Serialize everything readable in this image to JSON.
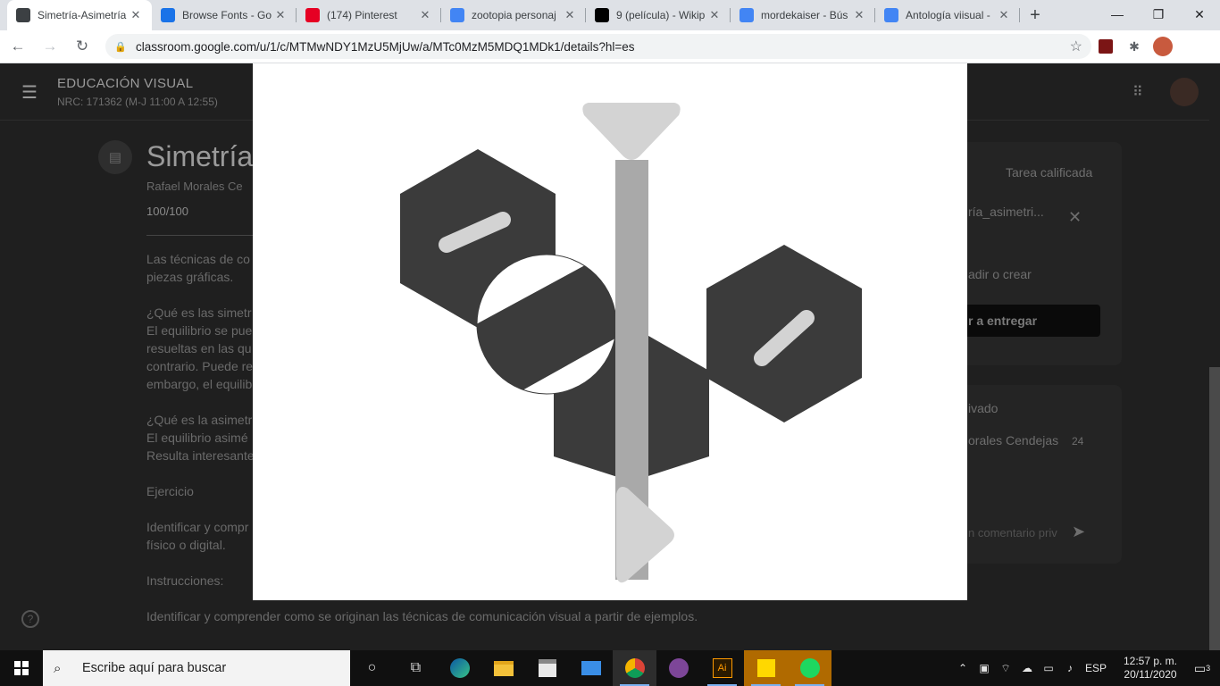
{
  "browser": {
    "tabs": [
      {
        "title": "Simetría-Asimetría",
        "favicon": "classroom-icon",
        "color": "#3c4043",
        "active": true
      },
      {
        "title": "Browse Fonts - Go",
        "favicon": "google-fonts-icon",
        "color": "#1a73e8",
        "active": false
      },
      {
        "title": "(174) Pinterest",
        "favicon": "pinterest-icon",
        "color": "#e60023",
        "active": false
      },
      {
        "title": "zootopia personaj",
        "favicon": "google-icon",
        "color": "#4285f4",
        "active": false
      },
      {
        "title": "9 (película) - Wikip",
        "favicon": "wikipedia-icon",
        "color": "#000000",
        "active": false
      },
      {
        "title": "mordekaiser - Bús",
        "favicon": "google-icon",
        "color": "#4285f4",
        "active": false
      },
      {
        "title": "Antología viisual -",
        "favicon": "docs-icon",
        "color": "#4285f4",
        "active": false
      }
    ],
    "new_tab": "+",
    "window_controls": {
      "minimize": "—",
      "restore": "❐",
      "close": "✕"
    },
    "url": "classroom.google.com/u/1/c/MTMwNDY1MzU5MjUw/a/MTc0MzM5MDQ1MDk1/details?hl=es"
  },
  "classroom": {
    "course_title": "EDUCACIÓN VISUAL",
    "course_sub": "NRC: 171362 (M-J 11:00 A 12:55)",
    "assignment_title": "Simetría",
    "author": "Rafael Morales Ce",
    "score": "100/100",
    "body": [
      "Las técnicas de co",
      "piezas gráficas.",
      "",
      "¿Qué es las simetr",
      "El equilibrio se pue",
      "resueltas en las qu",
      "contrario. Puede re",
      "embargo, el equilib",
      "",
      "¿Qué es la asimetr",
      "El equilibrio asimé",
      "Resulta interesante",
      "",
      "Ejercicio",
      "",
      "Identificar y compr",
      "físico o digital.",
      "",
      "Instrucciones:",
      "",
      "Identificar y comprender como se originan las técnicas de comunicación visual a partir de ejemplos."
    ],
    "side": {
      "graded_label": "Tarea calificada",
      "attachment": "ría_asimetri...",
      "add_create": "adir o crear",
      "submit": "r a entregar",
      "private_label": "ivado",
      "commenter": "orales Cendejas",
      "comment_time": "24",
      "comment_placeholder": "n comentario priv"
    }
  },
  "preview": {
    "colors": {
      "dark": "#3b3b3b",
      "mid": "#a9a9a9",
      "light": "#d3d3d3",
      "paper": "#ffffff"
    }
  },
  "taskbar": {
    "search_placeholder": "Escribe aquí para buscar",
    "apps": [
      "cortana-icon",
      "task-view-icon",
      "edge-icon",
      "file-explorer-icon",
      "store-icon",
      "mail-icon",
      "chrome-icon",
      "tor-icon",
      "illustrator-icon",
      "sticky-notes-icon",
      "spotify-icon"
    ],
    "language": "ESP",
    "time": "12:57 p. m.",
    "date": "20/11/2020",
    "notifications": "3"
  }
}
